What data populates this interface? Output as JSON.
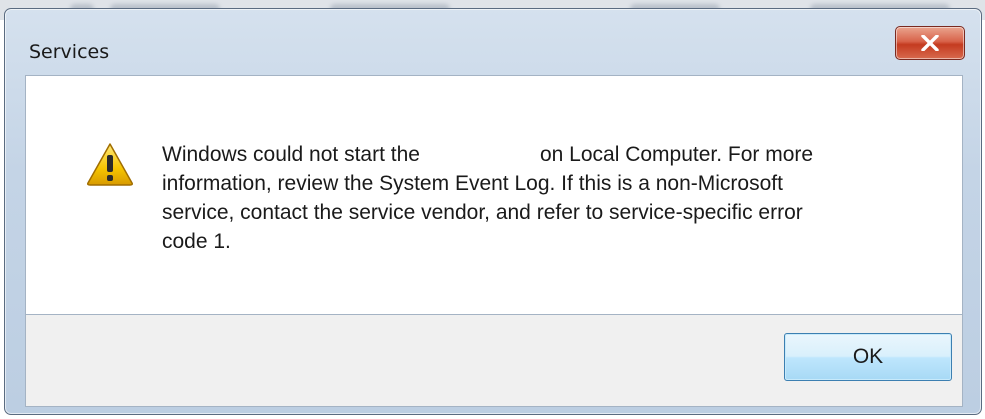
{
  "window": {
    "title": "Services"
  },
  "message": {
    "line1_start": "Windows could not start the",
    "line1_end": "on Local Computer. For more",
    "line2": "information, review the System Event Log. If this is a non-Microsoft",
    "line3": "service, contact the service vendor, and refer to service-specific error",
    "line4": "code 1."
  },
  "buttons": {
    "ok_label": "OK"
  },
  "icons": {
    "close": "close-icon",
    "warning": "warning-icon"
  },
  "colors": {
    "close_button": "#c43b20",
    "ok_button": "#bee6fd",
    "warning_yellow": "#f5c400"
  }
}
